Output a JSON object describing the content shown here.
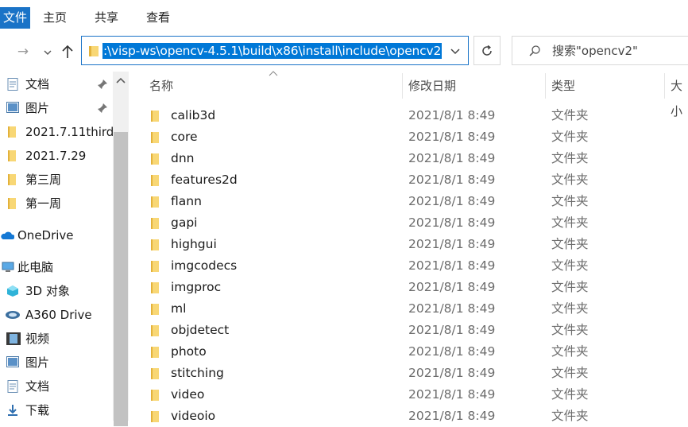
{
  "ribbon": {
    "file_tab": "文件",
    "tabs": [
      "主页",
      "共享",
      "查看"
    ]
  },
  "address": {
    "path": ":\\visp-ws\\opencv-4.5.1\\build\\x86\\install\\include\\opencv2"
  },
  "search": {
    "placeholder": "搜索\"opencv2\""
  },
  "columns": {
    "name": "名称",
    "date": "修改日期",
    "type": "类型",
    "size": "大小"
  },
  "sidebar": {
    "items": [
      {
        "label": "文档",
        "icon": "documents-icon",
        "pinned": true
      },
      {
        "label": "图片",
        "icon": "pictures-icon",
        "pinned": true
      },
      {
        "label": "2021.7.11third",
        "icon": "folder-icon"
      },
      {
        "label": "2021.7.29",
        "icon": "folder-icon"
      },
      {
        "label": "第三周",
        "icon": "folder-icon"
      },
      {
        "label": "第一周",
        "icon": "folder-icon"
      },
      {
        "label": "OneDrive",
        "icon": "onedrive-icon"
      },
      {
        "label": "此电脑",
        "icon": "this-pc-icon"
      },
      {
        "label": "3D 对象",
        "icon": "3d-objects-icon"
      },
      {
        "label": "A360 Drive",
        "icon": "a360-drive-icon"
      },
      {
        "label": "视频",
        "icon": "videos-icon"
      },
      {
        "label": "图片",
        "icon": "pictures-icon"
      },
      {
        "label": "文档",
        "icon": "documents-icon"
      },
      {
        "label": "下载",
        "icon": "downloads-icon"
      }
    ]
  },
  "files": [
    {
      "name": "calib3d",
      "date": "2021/8/1 8:49",
      "type": "文件夹"
    },
    {
      "name": "core",
      "date": "2021/8/1 8:49",
      "type": "文件夹"
    },
    {
      "name": "dnn",
      "date": "2021/8/1 8:49",
      "type": "文件夹"
    },
    {
      "name": "features2d",
      "date": "2021/8/1 8:49",
      "type": "文件夹"
    },
    {
      "name": "flann",
      "date": "2021/8/1 8:49",
      "type": "文件夹"
    },
    {
      "name": "gapi",
      "date": "2021/8/1 8:49",
      "type": "文件夹"
    },
    {
      "name": "highgui",
      "date": "2021/8/1 8:49",
      "type": "文件夹"
    },
    {
      "name": "imgcodecs",
      "date": "2021/8/1 8:49",
      "type": "文件夹"
    },
    {
      "name": "imgproc",
      "date": "2021/8/1 8:49",
      "type": "文件夹"
    },
    {
      "name": "ml",
      "date": "2021/8/1 8:49",
      "type": "文件夹"
    },
    {
      "name": "objdetect",
      "date": "2021/8/1 8:49",
      "type": "文件夹"
    },
    {
      "name": "photo",
      "date": "2021/8/1 8:49",
      "type": "文件夹"
    },
    {
      "name": "stitching",
      "date": "2021/8/1 8:49",
      "type": "文件夹"
    },
    {
      "name": "video",
      "date": "2021/8/1 8:49",
      "type": "文件夹"
    },
    {
      "name": "videoio",
      "date": "2021/8/1 8:49",
      "type": "文件夹"
    }
  ],
  "colors": {
    "accent": "#0078d7",
    "folder": "#f8d775"
  }
}
